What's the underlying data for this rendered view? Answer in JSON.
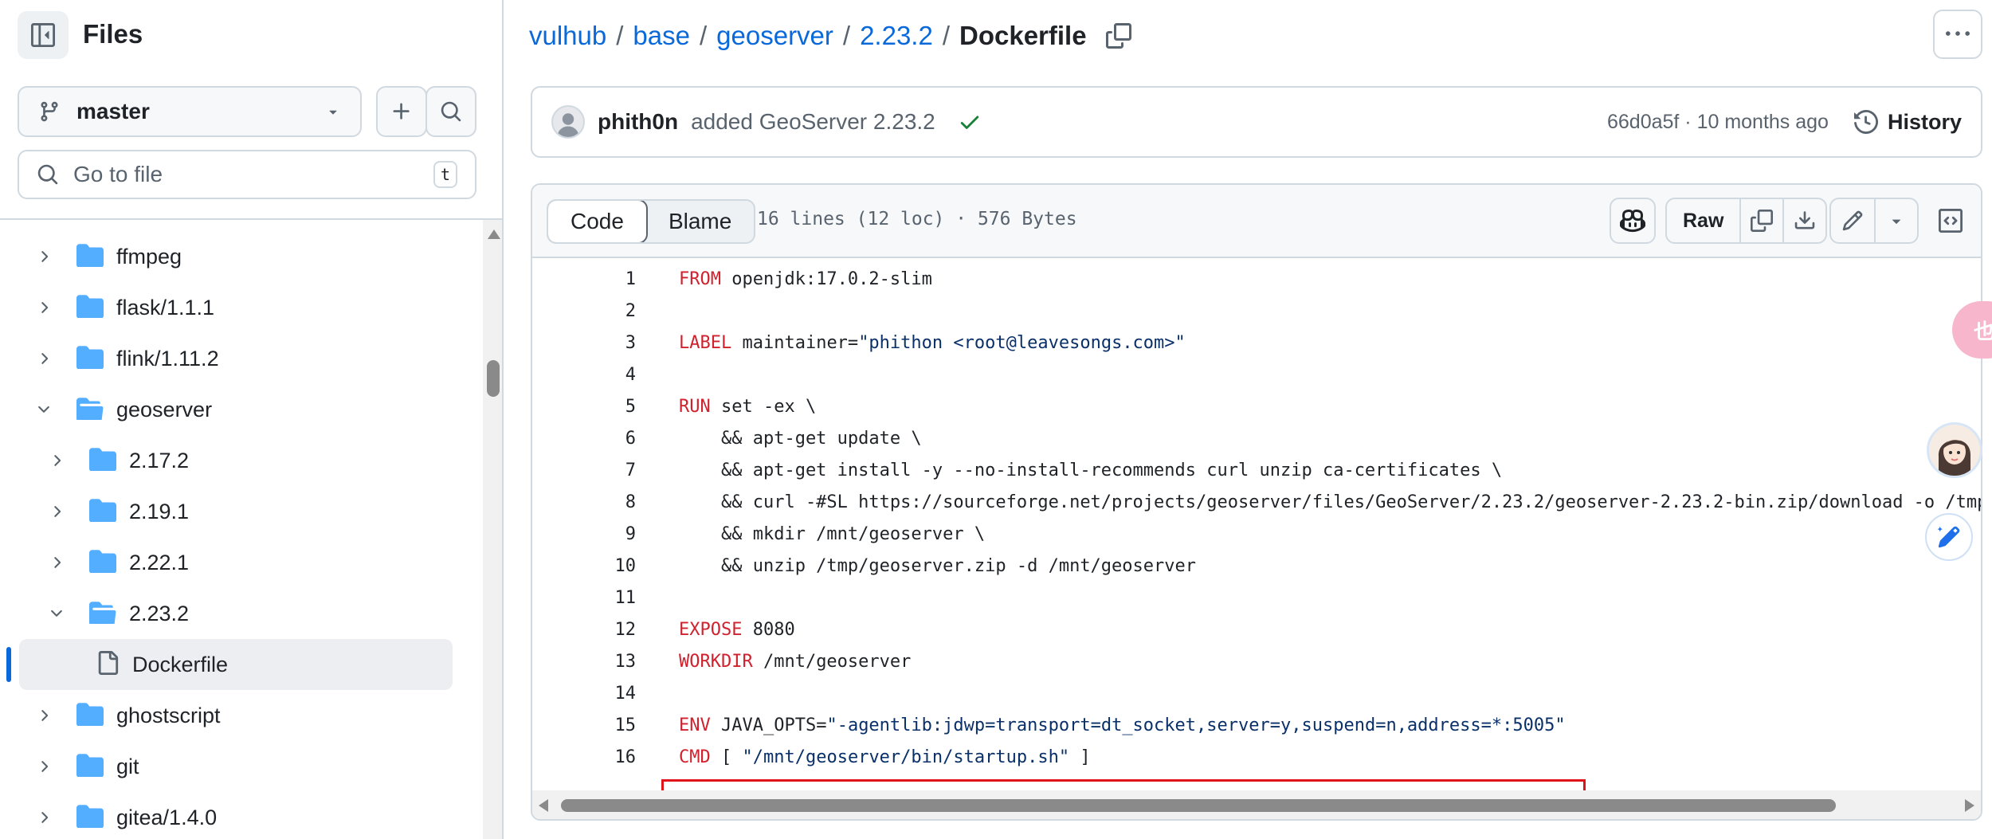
{
  "sidebar": {
    "title": "Files",
    "branch": "master",
    "goto_placeholder": "Go to file",
    "goto_shortcut": "t",
    "tree": [
      {
        "name": "ffmpeg",
        "expanded": false,
        "type": "folder"
      },
      {
        "name": "flask/1.1.1",
        "expanded": false,
        "type": "folder"
      },
      {
        "name": "flink/1.11.2",
        "expanded": false,
        "type": "folder"
      },
      {
        "name": "geoserver",
        "expanded": true,
        "type": "folder"
      },
      {
        "name": "2.17.2",
        "expanded": false,
        "type": "folder"
      },
      {
        "name": "2.19.1",
        "expanded": false,
        "type": "folder"
      },
      {
        "name": "2.22.1",
        "expanded": false,
        "type": "folder"
      },
      {
        "name": "2.23.2",
        "expanded": true,
        "type": "folder"
      },
      {
        "name": "Dockerfile",
        "type": "file",
        "selected": true
      },
      {
        "name": "ghostscript",
        "expanded": false,
        "type": "folder"
      },
      {
        "name": "git",
        "expanded": false,
        "type": "folder"
      },
      {
        "name": "gitea/1.4.0",
        "expanded": false,
        "type": "folder"
      }
    ]
  },
  "breadcrumb": {
    "items": [
      "vulhub",
      "base",
      "geoserver",
      "2.23.2"
    ],
    "current": "Dockerfile"
  },
  "commit": {
    "author": "phith0n",
    "message": "added GeoServer 2.23.2",
    "meta": "66d0a5f · 10 months ago",
    "history_label": "History"
  },
  "file": {
    "tab_code": "Code",
    "tab_blame": "Blame",
    "info": "16 lines (12 loc) · 576 Bytes",
    "raw_label": "Raw",
    "highlighted_line": 15
  },
  "code_lines": [
    [
      {
        "t": "FROM",
        "c": "kw"
      },
      {
        "t": " openjdk:17.0.2-slim"
      }
    ],
    [],
    [
      {
        "t": "LABEL",
        "c": "kw"
      },
      {
        "t": " maintainer="
      },
      {
        "t": "\"phithon <root@leavesongs.com>\"",
        "c": "str"
      }
    ],
    [],
    [
      {
        "t": "RUN",
        "c": "kw"
      },
      {
        "t": " set -ex \\"
      }
    ],
    [
      {
        "t": "    && apt-get update \\"
      }
    ],
    [
      {
        "t": "    && apt-get install -y --no-install-recommends curl unzip ca-certificates \\"
      }
    ],
    [
      {
        "t": "    && curl -#SL https://sourceforge.net/projects/geoserver/files/GeoServer/2.23.2/geoserver-2.23.2-bin.zip/download -o /tmp"
      }
    ],
    [
      {
        "t": "    && mkdir /mnt/geoserver \\"
      }
    ],
    [
      {
        "t": "    && unzip /tmp/geoserver.zip -d /mnt/geoserver"
      }
    ],
    [],
    [
      {
        "t": "EXPOSE",
        "c": "kw"
      },
      {
        "t": " 8080"
      }
    ],
    [
      {
        "t": "WORKDIR",
        "c": "kw"
      },
      {
        "t": " /mnt/geoserver"
      }
    ],
    [],
    [
      {
        "t": "ENV",
        "c": "kw"
      },
      {
        "t": " JAVA_OPTS="
      },
      {
        "t": "\"-agentlib:jdwp=transport=dt_socket,server=y,suspend=n,address=*:5005\"",
        "c": "str"
      }
    ],
    [
      {
        "t": "CMD",
        "c": "kw"
      },
      {
        "t": " [ "
      },
      {
        "t": "\"/mnt/geoserver/bin/startup.sh\"",
        "c": "str"
      },
      {
        "t": " ]"
      }
    ]
  ],
  "widgets": {
    "pink_label": "也"
  },
  "colors": {
    "link": "#0969da",
    "keyword": "#cf222e",
    "string": "#0a3069",
    "highlight_box": "#e0121a",
    "success": "#1a7f37"
  }
}
